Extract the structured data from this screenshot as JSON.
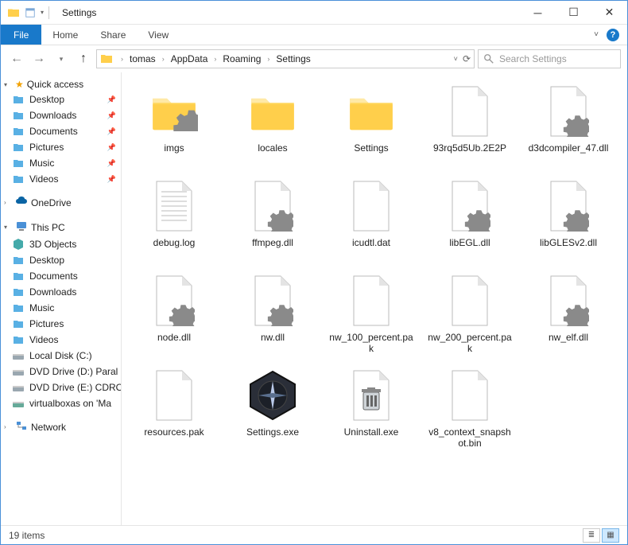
{
  "window": {
    "title": "Settings"
  },
  "ribbon": {
    "file": "File",
    "tabs": [
      "Home",
      "Share",
      "View"
    ]
  },
  "breadcrumbs": [
    "tomas",
    "AppData",
    "Roaming",
    "Settings"
  ],
  "search": {
    "placeholder": "Search Settings"
  },
  "nav": {
    "quick": {
      "label": "Quick access",
      "items": [
        {
          "label": "Desktop",
          "icon": "desktop",
          "pin": true
        },
        {
          "label": "Downloads",
          "icon": "down",
          "pin": true
        },
        {
          "label": "Documents",
          "icon": "doc",
          "pin": true
        },
        {
          "label": "Pictures",
          "icon": "pic",
          "pin": true
        },
        {
          "label": "Music",
          "icon": "music",
          "pin": true
        },
        {
          "label": "Videos",
          "icon": "video",
          "pin": true
        }
      ]
    },
    "onedrive": "OneDrive",
    "thispc": {
      "label": "This PC",
      "items": [
        {
          "label": "3D Objects",
          "icon": "cube"
        },
        {
          "label": "Desktop",
          "icon": "desktop"
        },
        {
          "label": "Documents",
          "icon": "doc"
        },
        {
          "label": "Downloads",
          "icon": "down"
        },
        {
          "label": "Music",
          "icon": "music"
        },
        {
          "label": "Pictures",
          "icon": "pic"
        },
        {
          "label": "Videos",
          "icon": "video"
        },
        {
          "label": "Local Disk (C:)",
          "icon": "drive"
        },
        {
          "label": "DVD Drive (D:) Paral",
          "icon": "dvd"
        },
        {
          "label": "DVD Drive (E:) CDRO",
          "icon": "dvd"
        },
        {
          "label": "virtualboxas on 'Ma",
          "icon": "netdrive"
        }
      ]
    },
    "network": "Network"
  },
  "files": [
    {
      "name": "imgs",
      "type": "folder-gear"
    },
    {
      "name": "locales",
      "type": "folder"
    },
    {
      "name": "Settings",
      "type": "folder"
    },
    {
      "name": "93rq5d5Ub.2E2P",
      "type": "file"
    },
    {
      "name": "d3dcompiler_47.dll",
      "type": "dll"
    },
    {
      "name": "debug.log",
      "type": "log"
    },
    {
      "name": "ffmpeg.dll",
      "type": "dll"
    },
    {
      "name": "icudtl.dat",
      "type": "file"
    },
    {
      "name": "libEGL.dll",
      "type": "dll"
    },
    {
      "name": "libGLESv2.dll",
      "type": "dll"
    },
    {
      "name": "node.dll",
      "type": "dll"
    },
    {
      "name": "nw.dll",
      "type": "dll"
    },
    {
      "name": "nw_100_percent.pak",
      "type": "file"
    },
    {
      "name": "nw_200_percent.pak",
      "type": "file"
    },
    {
      "name": "nw_elf.dll",
      "type": "dll"
    },
    {
      "name": "resources.pak",
      "type": "file"
    },
    {
      "name": "Settings.exe",
      "type": "settings-exe"
    },
    {
      "name": "Uninstall.exe",
      "type": "uninstall-exe"
    },
    {
      "name": "v8_context_snapshot.bin",
      "type": "file"
    }
  ],
  "status": {
    "count": "19 items"
  }
}
